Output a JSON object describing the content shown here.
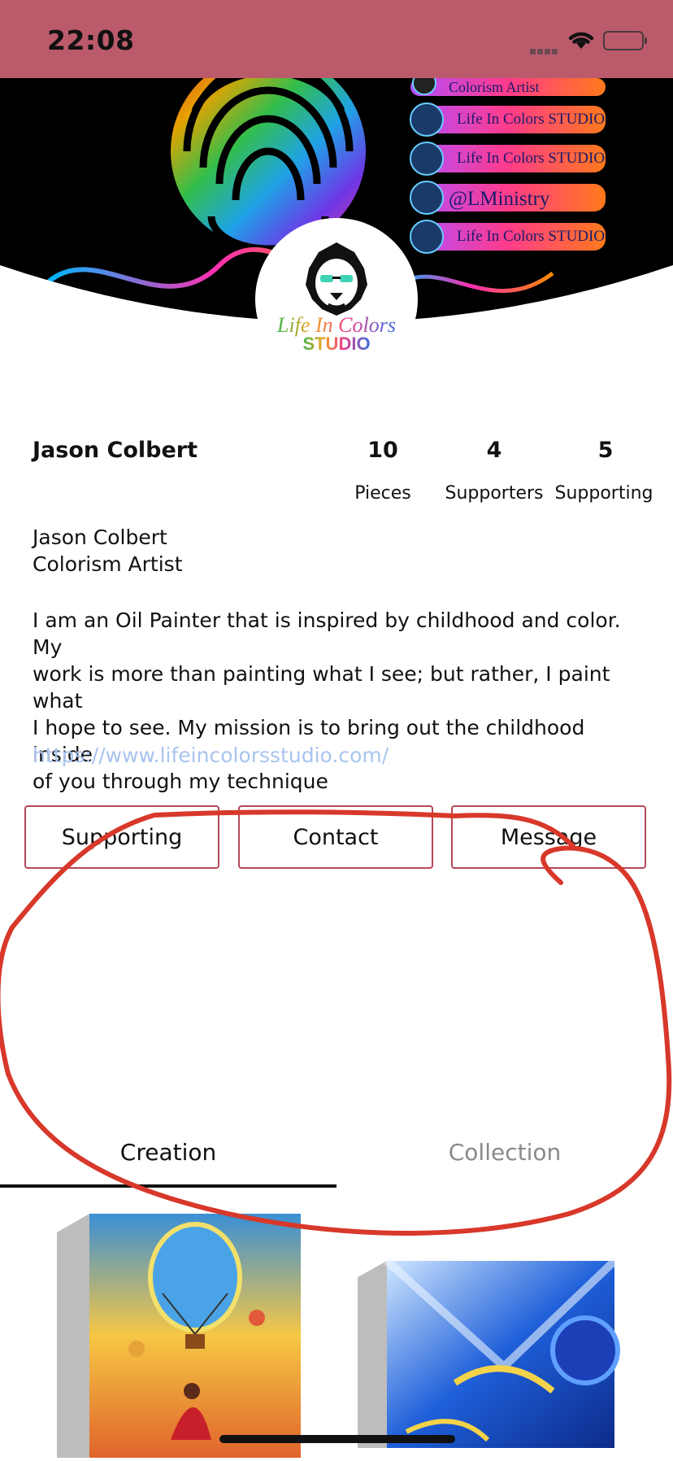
{
  "status_bar": {
    "time": "22:08",
    "background": "#bb5a6b"
  },
  "banner": {
    "social_labels": [
      "Colorism Artist",
      "Life In Colors STUDIO",
      "Life In Colors STUDIO",
      "@LMinistry",
      "Life In Colors STUDIO"
    ]
  },
  "avatar": {
    "logo_line1": "Life In Colors",
    "logo_line2": "STUDIO"
  },
  "profile": {
    "name": "Jason Colbert",
    "stats": [
      {
        "value": "10",
        "label": "Pieces"
      },
      {
        "value": "4",
        "label": "Supporters"
      },
      {
        "value": "5",
        "label": "Supporting"
      }
    ],
    "bio_name": "Jason Colbert",
    "bio_title": "Colorism Artist",
    "description_lines": [
      "I am an Oil Painter that is inspired by childhood and color. My",
      "work is more than painting what I see; but rather, I paint what",
      "I hope to see. My mission is to bring out the childhood inside",
      "of you through my technique"
    ],
    "website": "https://www.lifeincolorsstudio.com/"
  },
  "actions": {
    "supporting": "Supporting",
    "contact": "Contact",
    "message": "Message"
  },
  "tabs": {
    "creation": "Creation",
    "collection": "Collection",
    "active": "Creation"
  },
  "colors": {
    "accent": "#b6475a",
    "link": "#a9c4ef",
    "annotation": "#d8382a"
  }
}
